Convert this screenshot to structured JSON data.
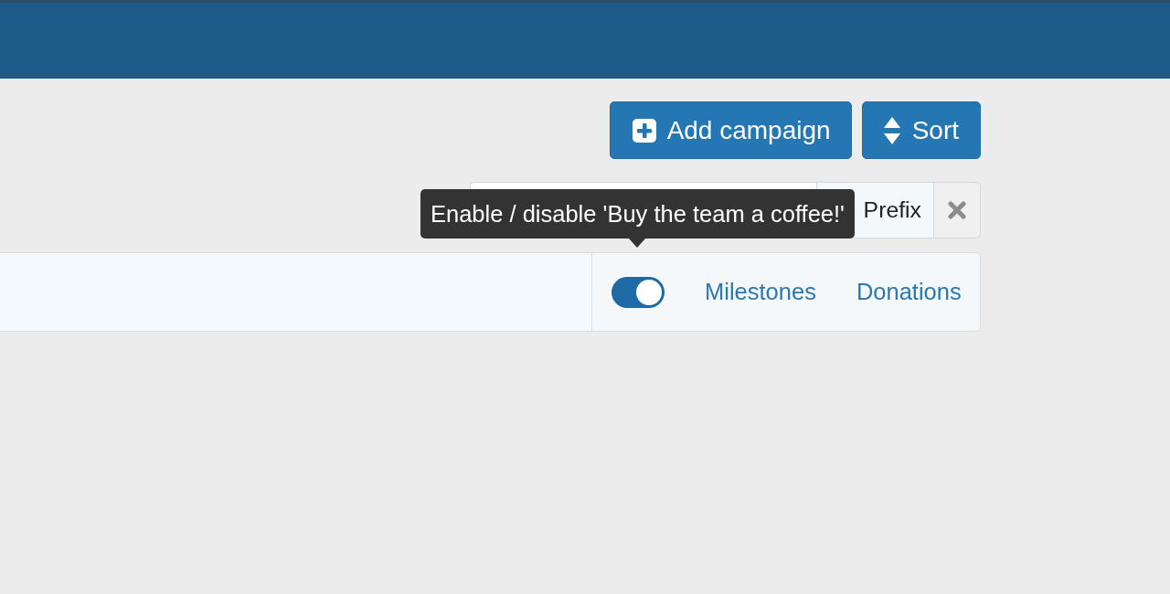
{
  "toolbar": {
    "buttons": [
      {
        "kind": "add",
        "label": "Add campaign"
      },
      {
        "kind": "sort",
        "label": "Sort"
      }
    ]
  },
  "filter_bar": {
    "prefix": {
      "label": "Prefix"
    }
  },
  "tooltip": {
    "text": "Enable / disable 'Buy the team a coffee!'"
  },
  "campaign_row": {
    "enabled": true,
    "links": [
      "Milestones",
      "Donations"
    ]
  }
}
